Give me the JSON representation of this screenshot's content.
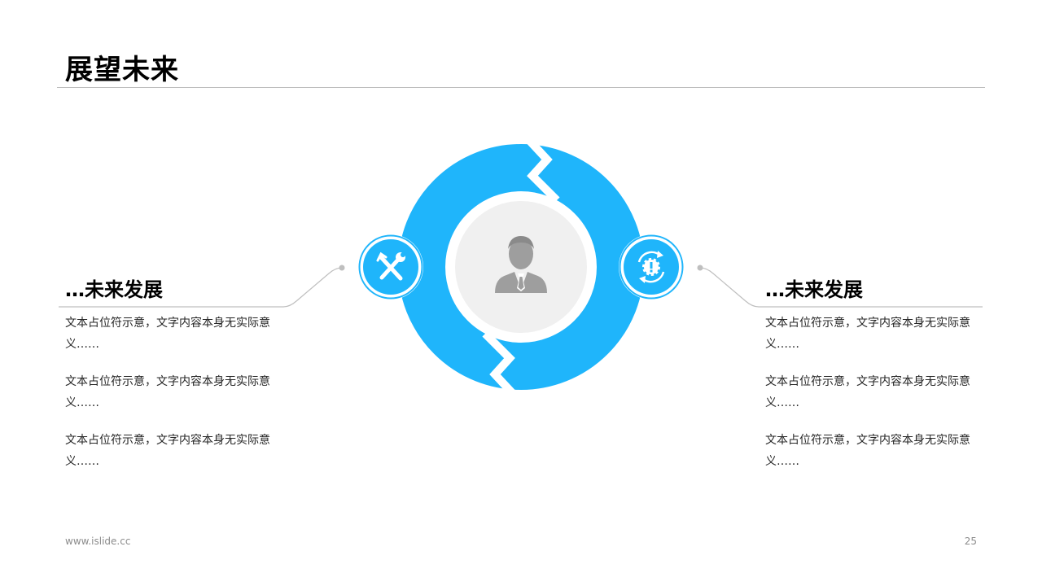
{
  "slide": {
    "title": "展望未来",
    "page_number": "25",
    "footer_url": "www.islide.cc"
  },
  "left_panel": {
    "heading": "…未来发展",
    "items": [
      "文本占位符示意，文字内容本身无实际意义……",
      "文本占位符示意，文字内容本身无实际意义……",
      "文本占位符示意，文字内容本身无实际意义……"
    ]
  },
  "right_panel": {
    "heading": "…未来发展",
    "items": [
      "文本占位符示意，文字内容本身无实际意义……",
      "文本占位符示意，文字内容本身无实际意义……",
      "文本占位符示意，文字内容本身无实际意义……"
    ]
  },
  "icons": {
    "center": "person-icon",
    "left_node": "tools-icon",
    "right_node": "gear-cycle-icon"
  },
  "colors": {
    "accent": "#1fb5fb",
    "accent_dark": "#12a7f0",
    "center_fill": "#f0f0f0",
    "person_gray": "#9e9e9e",
    "connector": "#bfbfbf"
  }
}
